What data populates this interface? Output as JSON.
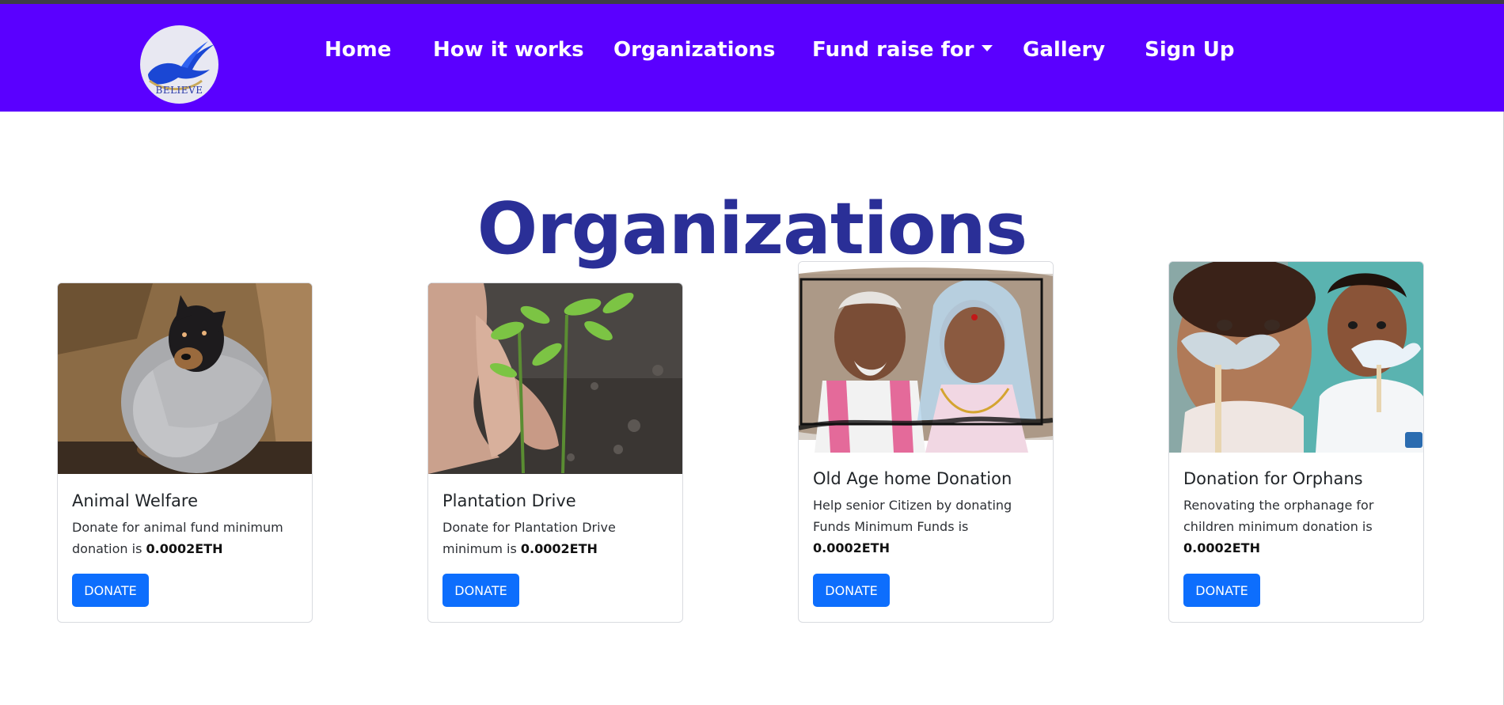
{
  "brand": {
    "logo_text": "BELIEVE"
  },
  "nav": {
    "items": [
      {
        "label": "Home"
      },
      {
        "label": "How it works"
      },
      {
        "label": "Organizations"
      },
      {
        "label": "Fund raise for",
        "has_dropdown": true
      },
      {
        "label": "Gallery"
      },
      {
        "label": "Sign Up"
      }
    ]
  },
  "page": {
    "title": "Organizations"
  },
  "cards": [
    {
      "title": "Animal Welfare",
      "text": "Donate for animal fund minimum donation is",
      "amount": "0.0002ETH",
      "button": "DONATE",
      "image": "puppy-in-box"
    },
    {
      "title": "Plantation Drive",
      "text": "Donate for Plantation Drive minimum is",
      "amount": "0.0002ETH",
      "button": "DONATE",
      "image": "hands-planting-seedling"
    },
    {
      "title": "Old Age home Donation",
      "text": "Help senior Citizen by donating Funds Minimum Funds is",
      "amount": "0.0002ETH",
      "button": "DONATE",
      "image": "elderly-couple"
    },
    {
      "title": "Donation for Orphans",
      "text": "Renovating the orphanage for children minimum donation is",
      "amount": "0.0002ETH",
      "button": "DONATE",
      "image": "children-with-paper-birds"
    }
  ],
  "colors": {
    "navbar": "#5a00ff",
    "title": "#2a2f97",
    "button": "#0d6efd"
  }
}
